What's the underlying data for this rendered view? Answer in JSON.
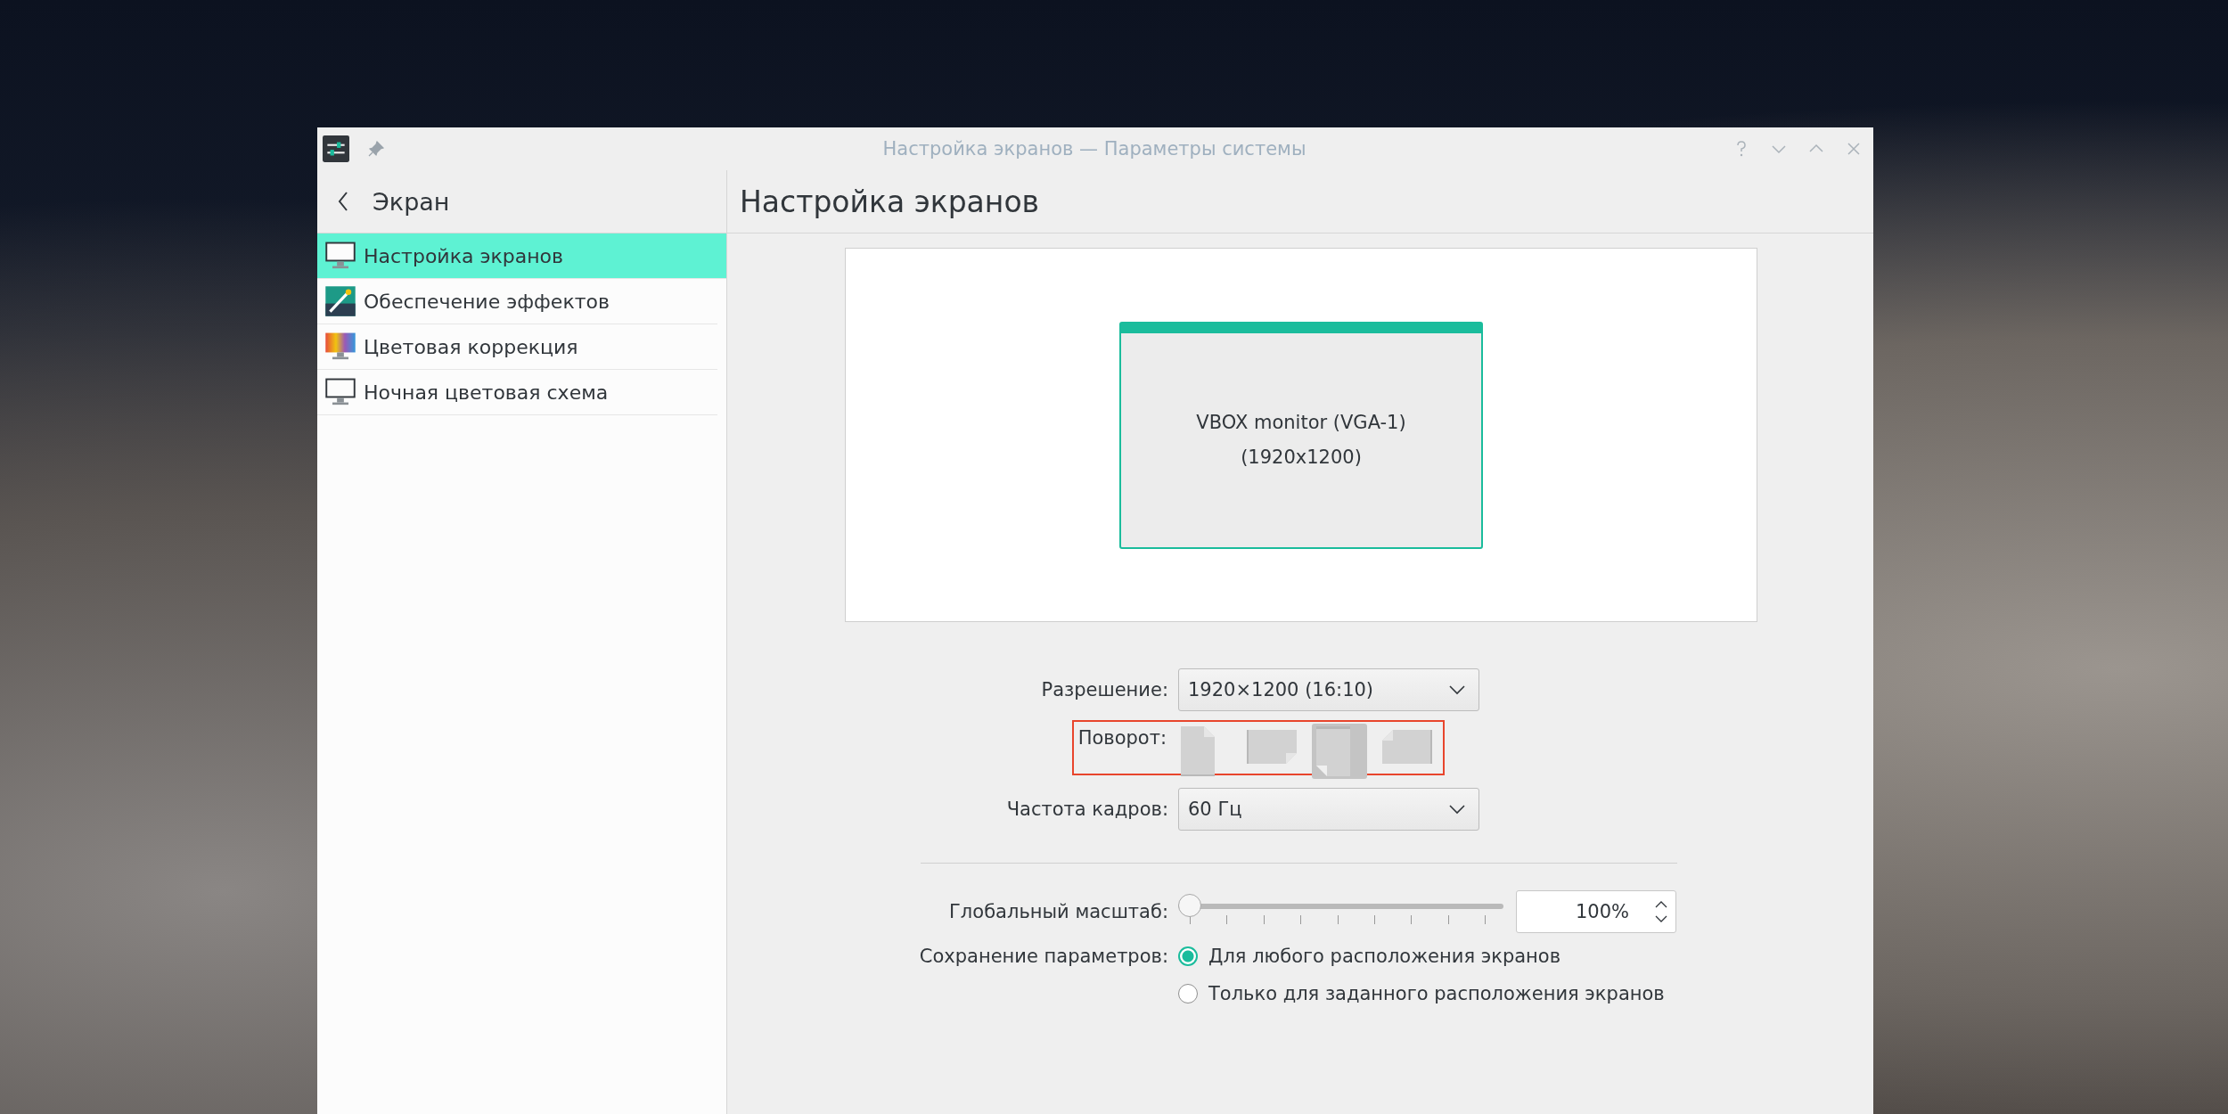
{
  "window": {
    "title": "Настройка экранов — Параметры системы"
  },
  "sidebar": {
    "back_label": "Экран",
    "items": [
      {
        "label": "Настройка экранов",
        "kind": "monitor",
        "selected": true
      },
      {
        "label": "Обеспечение эффектов",
        "kind": "effects",
        "selected": false
      },
      {
        "label": "Цветовая коррекция",
        "kind": "color",
        "selected": false
      },
      {
        "label": "Ночная цветовая схема",
        "kind": "monitor",
        "selected": false
      }
    ]
  },
  "page": {
    "title": "Настройка экранов"
  },
  "preview": {
    "outputs": [
      {
        "name": "VBOX monitor (VGA-1)",
        "resolution": "(1920x1200)"
      }
    ]
  },
  "form": {
    "resolution": {
      "label": "Разрешение:",
      "value": "1920×1200 (16:10)"
    },
    "rotation": {
      "label": "Поворот:",
      "highlighted": true,
      "options": [
        {
          "kind": "normal",
          "selected": false
        },
        {
          "kind": "left",
          "selected": false
        },
        {
          "kind": "inverted",
          "selected": true
        },
        {
          "kind": "right",
          "selected": false
        }
      ]
    },
    "refresh_rate": {
      "label": "Частота кадров:",
      "value": "60 Гц"
    },
    "global_scale": {
      "label": "Глобальный масштаб:",
      "level": 0,
      "value": "100%"
    },
    "save_settings": {
      "label": "Сохранение параметров:",
      "options": [
        {
          "label": "Для любого расположения экранов",
          "selected": true
        },
        {
          "label": "Только для заданного расположения экранов",
          "selected": false
        }
      ]
    }
  }
}
